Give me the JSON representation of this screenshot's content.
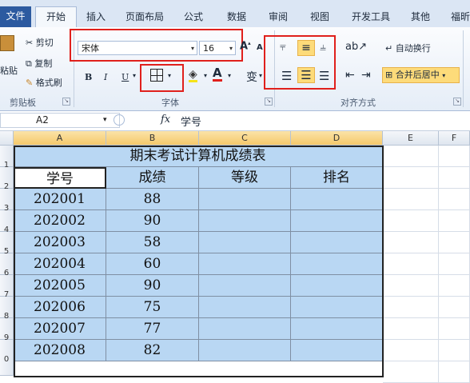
{
  "tabs": [
    "文件",
    "开始",
    "插入",
    "页面布局",
    "公式",
    "数据",
    "审阅",
    "视图",
    "开发工具",
    "其他",
    "福昕"
  ],
  "clipboard": {
    "paste": "粘贴",
    "cut": "剪切",
    "copy": "复制",
    "format_painter": "格式刷",
    "group_label": "剪贴板"
  },
  "font": {
    "name": "宋体",
    "size": "16",
    "bold": "B",
    "italic": "I",
    "underline": "U",
    "group_label": "字体"
  },
  "alignment": {
    "wrap_text": "自动换行",
    "merge_center": "合并后居中",
    "group_label": "对齐方式"
  },
  "formula_bar": {
    "name_box": "A2",
    "fx": "fx",
    "content": "学号"
  },
  "columns": [
    "A",
    "B",
    "C",
    "D",
    "E",
    "F"
  ],
  "row_numbers": [
    "1",
    "2",
    "3",
    "4",
    "5",
    "6",
    "7",
    "8",
    "9",
    "0"
  ],
  "sheet": {
    "title": "期末考试计算机成绩表",
    "headers": [
      "学号",
      "成绩",
      "等级",
      "排名"
    ],
    "rows": [
      [
        "202001",
        "88"
      ],
      [
        "202002",
        "90"
      ],
      [
        "202003",
        "58"
      ],
      [
        "202004",
        "60"
      ],
      [
        "202005",
        "90"
      ],
      [
        "202006",
        "75"
      ],
      [
        "202007",
        "77"
      ],
      [
        "202008",
        "82"
      ]
    ]
  },
  "colors": {
    "selection_fill": "#b9d7f3",
    "highlight_box": "#e0201c",
    "active_button": "#fddb7a"
  }
}
